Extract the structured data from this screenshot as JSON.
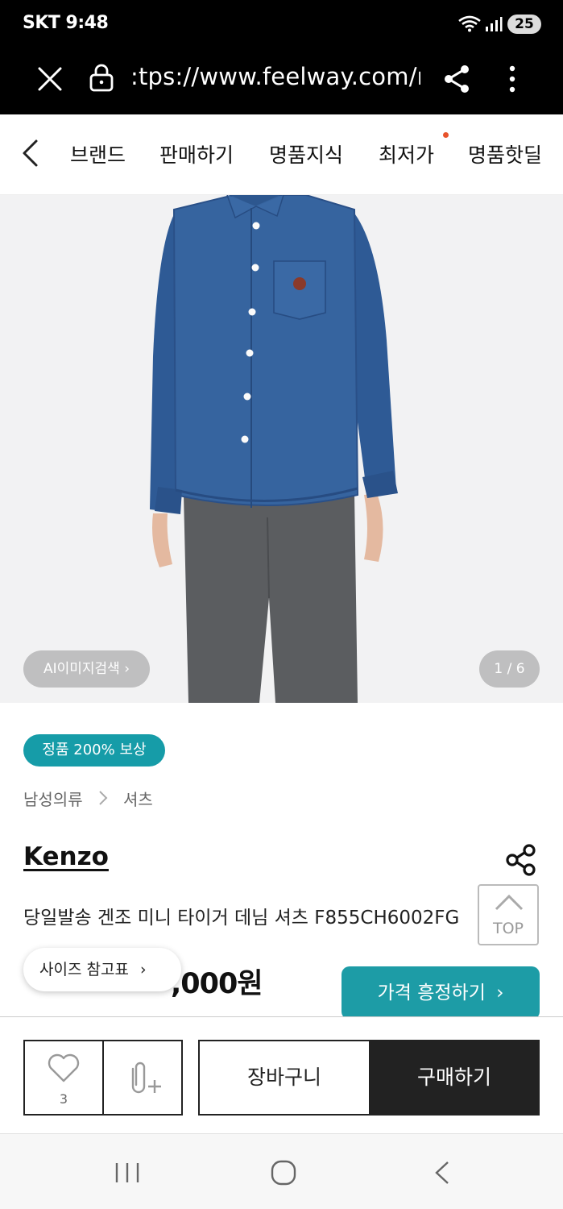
{
  "status_bar": {
    "carrier_time": "SKT 9:48",
    "battery": "25"
  },
  "browser": {
    "url": ":tps://www.feelway.com/r"
  },
  "nav": {
    "items": [
      "브랜드",
      "판매하기",
      "명품지식",
      "최저가",
      "명품핫딜"
    ]
  },
  "gallery": {
    "ai_search_label": "AI이미지검색",
    "counter": "1 / 6"
  },
  "product": {
    "guarantee_badge": "정품 200% 보상",
    "category_1": "남성의류",
    "category_2": "셔츠",
    "brand": "Kenzo",
    "title": "당일발송 겐조 미니 타이거 데님 셔츠 F855CH6002FG",
    "price_visible": ",000원"
  },
  "size_chart_label": "사이즈 참고표",
  "top_button_label": "TOP",
  "offer_toast": "가격 흥정하기",
  "actions": {
    "wish_count": "3",
    "cart_label": "장바구니",
    "buy_label": "구매하기"
  },
  "colors": {
    "accent": "#169ca8",
    "buy_bg": "#222222",
    "nav_dot": "#e8532c"
  }
}
